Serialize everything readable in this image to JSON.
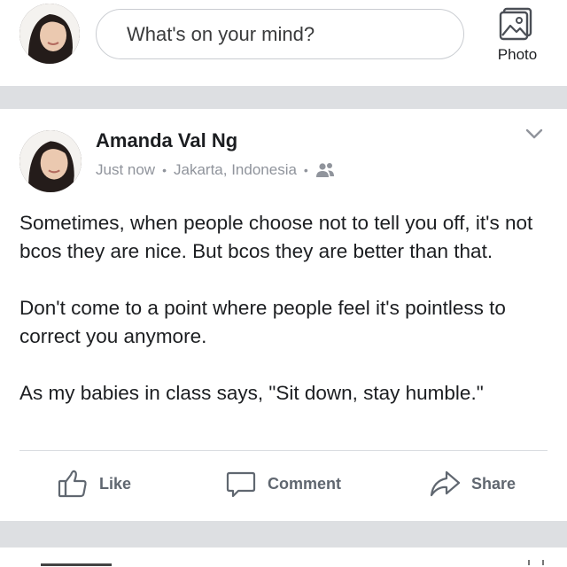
{
  "composer": {
    "placeholder": "What's on your mind?",
    "photo_label": "Photo"
  },
  "post": {
    "author": "Amanda Val Ng",
    "time": "Just now",
    "location": "Jakarta, Indonesia",
    "audience_icon": "friends-icon",
    "paragraphs": [
      "Sometimes, when people choose not to tell you off, it's not bcos they are nice. But bcos they are better than that.",
      "Don't come to a point where people feel it's pointless to correct you anymore.",
      "As my babies in class says, \"Sit down, stay humble.\""
    ],
    "actions": {
      "like": "Like",
      "comment": "Comment",
      "share": "Share"
    }
  },
  "colors": {
    "band": "#dddfe2",
    "meta_text": "#90949c",
    "action_text": "#606770"
  }
}
